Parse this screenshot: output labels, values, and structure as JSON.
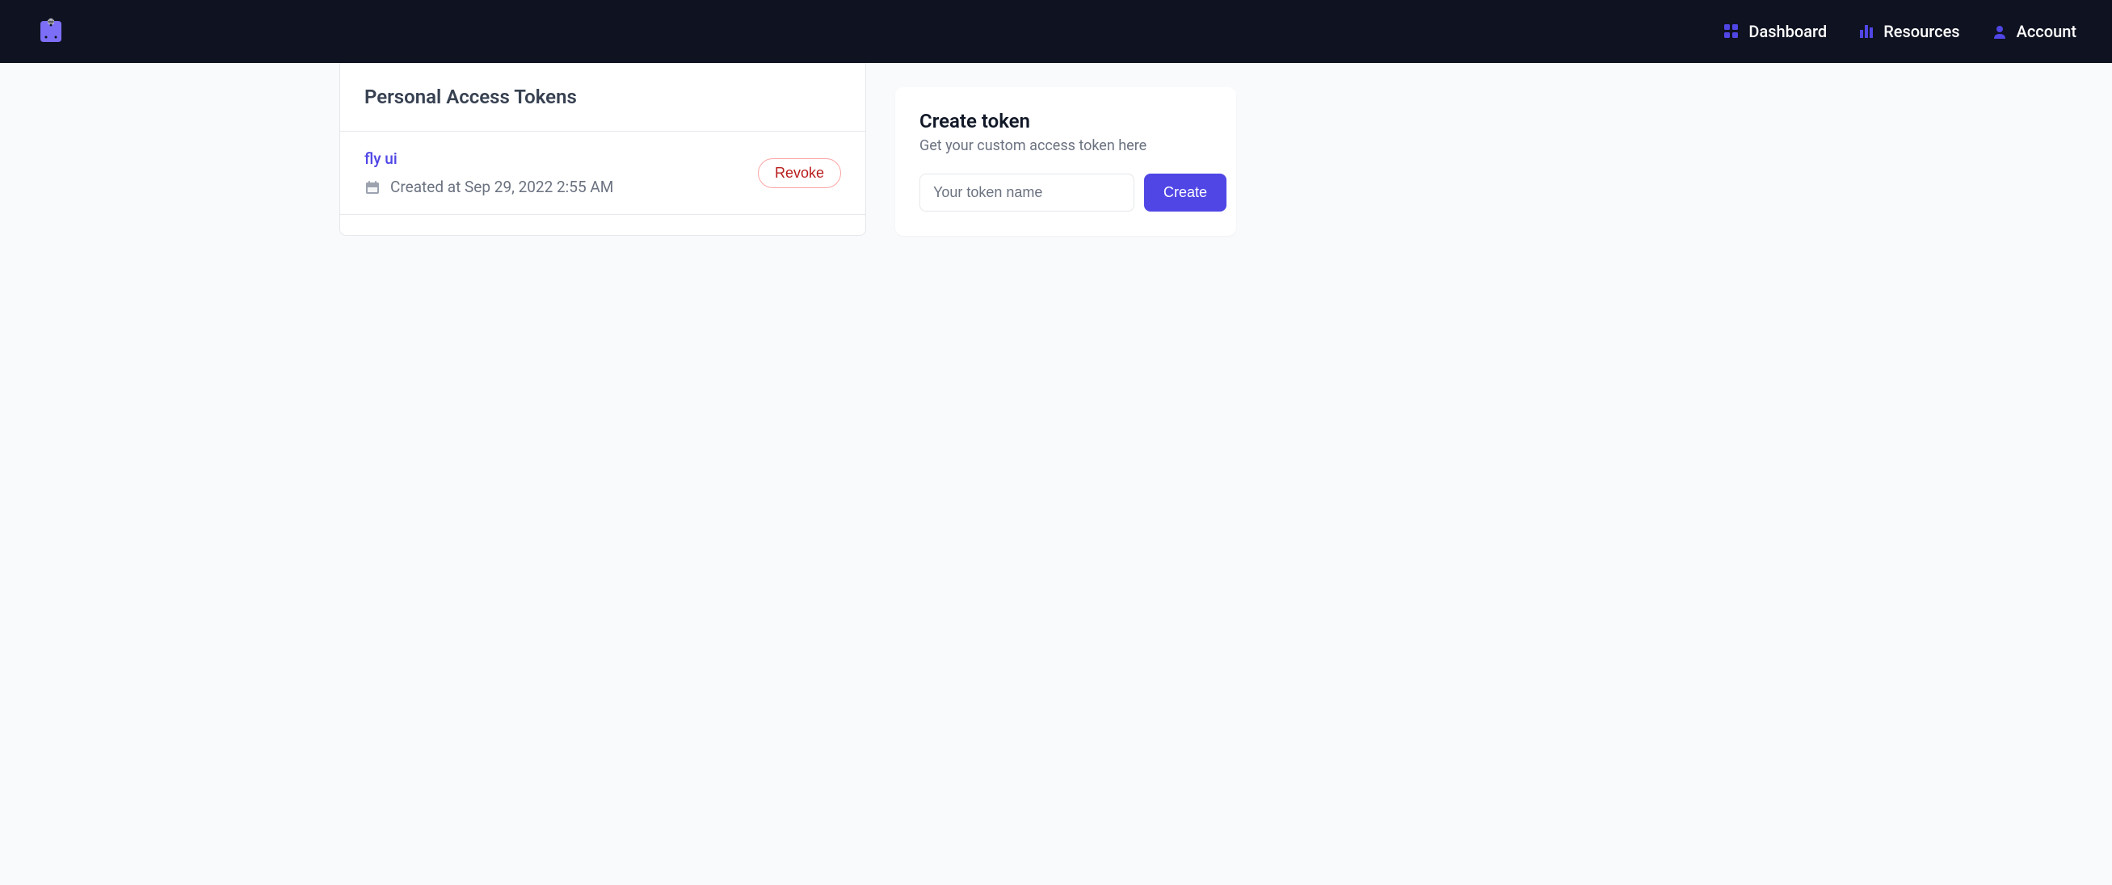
{
  "nav": {
    "dashboard": "Dashboard",
    "resources": "Resources",
    "account": "Account"
  },
  "main": {
    "title": "Personal Access Tokens",
    "tokens": [
      {
        "name": "fly ui",
        "created": "Created at Sep 29, 2022 2:55 AM",
        "revoke_label": "Revoke"
      }
    ]
  },
  "sidebar": {
    "title": "Create token",
    "subtitle": "Get your custom access token here",
    "input_placeholder": "Your token name",
    "create_label": "Create"
  }
}
